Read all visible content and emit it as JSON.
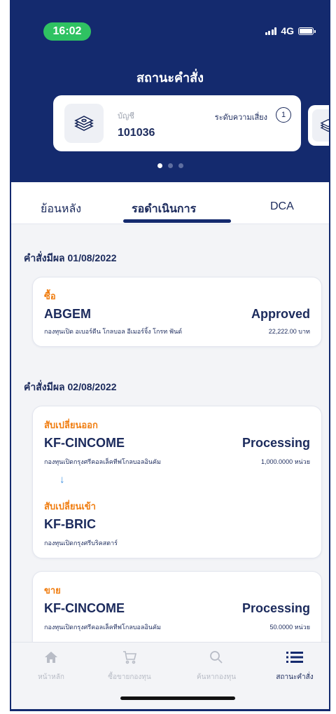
{
  "status_bar": {
    "time": "16:02",
    "network": "4G"
  },
  "header": {
    "title": "สถานะคำสั่ง"
  },
  "account_card": {
    "label": "บัญชี",
    "number": "101036",
    "risk_label": "ระดับความเสี่ยง",
    "risk_level": "1",
    "icon": "money-stack-icon"
  },
  "carousel": {
    "pages": 3,
    "active_index": 0
  },
  "tabs": [
    {
      "label": "ย้อนหลัง",
      "active": false
    },
    {
      "label": "รอดำเนินการ",
      "active": true
    },
    {
      "label": "DCA",
      "active": false
    }
  ],
  "sections": [
    {
      "heading": "คำสั่งมีผล 01/08/2022",
      "cards": [
        {
          "type": "ซื้อ",
          "fund": "ABGEM",
          "description": "กองทุนเปิด อเบอร์ดีน โกลบอล อีเมอร์จิ้ง โกรท ฟันด์",
          "status": "Approved",
          "amount": "22,222.00 บาท"
        }
      ]
    },
    {
      "heading": "คำสั่งมีผล 02/08/2022",
      "cards": [
        {
          "type": "สับเปลี่ยนออก",
          "fund": "KF-CINCOME",
          "description": "กองทุนเปิดกรุงศรีคอลเล็คทีฟโกลบอลอินคัม",
          "status": "Processing",
          "amount": "1,000.0000 หน่วย",
          "arrow": "↓",
          "switch_in": {
            "type": "สับเปลี่ยนเข้า",
            "fund": "KF-BRIC",
            "description": "กองทุนเปิดกรุงศรีบริคสตาร์"
          }
        },
        {
          "type": "ขาย",
          "fund": "KF-CINCOME",
          "description": "กองทุนเปิดกรุงศรีคอลเล็คทีฟโกลบอลอินคัม",
          "status": "Processing",
          "amount": "50.0000 หน่วย"
        }
      ]
    }
  ],
  "bottom_nav": [
    {
      "label": "หน้าหลัก",
      "icon": "home-icon",
      "active": false
    },
    {
      "label": "ซื้อขายกองทุน",
      "icon": "cart-icon",
      "active": false
    },
    {
      "label": "ค้นหากองทุน",
      "icon": "search-icon",
      "active": false
    },
    {
      "label": "สถานะคำสั่ง",
      "icon": "list-icon",
      "active": true
    }
  ],
  "colors": {
    "navy": "#142a6e",
    "orange": "#f07e12",
    "green": "#2fc262",
    "arrow_blue": "#3c8fe0"
  }
}
